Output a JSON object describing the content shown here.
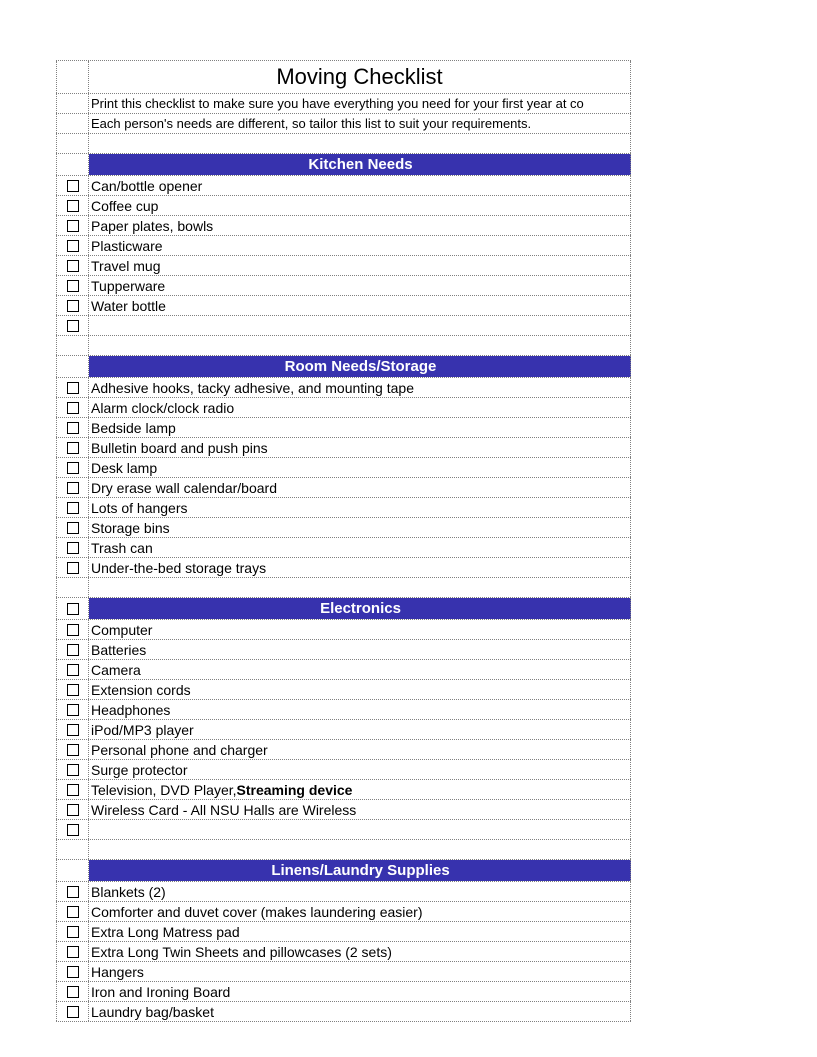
{
  "title": "Moving Checklist",
  "intro_line1": "Print this checklist to make sure you have everything you need for your first year at co",
  "intro_line2": "Each person's needs are different, so tailor this list to suit your requirements.",
  "sections": [
    {
      "header": "Kitchen Needs",
      "items": [
        "Can/bottle opener",
        "Coffee cup",
        "Paper plates, bowls",
        "Plasticware",
        "Travel mug",
        "Tupperware",
        "Water bottle",
        ""
      ]
    },
    {
      "header": "Room Needs/Storage",
      "items": [
        "Adhesive hooks, tacky adhesive, and mounting tape",
        "Alarm clock/clock radio",
        "Bedside lamp",
        "Bulletin board and push pins",
        "Desk lamp",
        "Dry erase wall calendar/board",
        "Lots of hangers",
        "Storage bins",
        "Trash can",
        "Under-the-bed storage trays"
      ]
    },
    {
      "header": "Electronics",
      "header_has_checkbox": true,
      "items": [
        "Computer",
        "Batteries",
        "Camera",
        "Extension cords",
        "Headphones",
        "iPod/MP3 player",
        "Personal phone and charger",
        "Surge protector",
        {
          "text": "Television, DVD Player, ",
          "bold_suffix": "Streaming device"
        },
        "Wireless Card - All NSU Halls are Wireless",
        ""
      ]
    },
    {
      "header": "Linens/Laundry Supplies",
      "items": [
        "Blankets (2)",
        "Comforter and duvet cover (makes laundering easier)",
        "Extra Long Matress pad",
        "Extra Long Twin Sheets and pillowcases (2 sets)",
        "Hangers",
        "Iron and Ironing Board",
        "Laundry bag/basket"
      ]
    }
  ]
}
